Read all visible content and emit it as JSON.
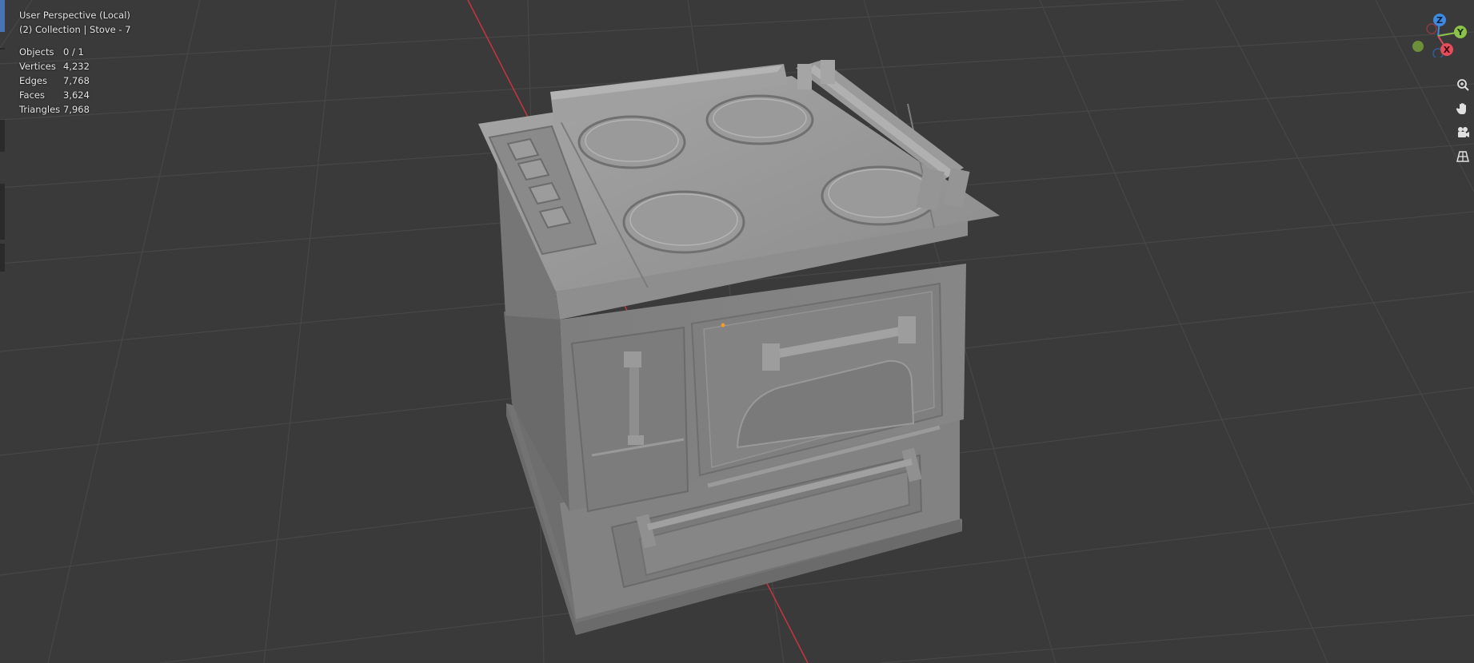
{
  "viewport": {
    "view_label": "User Perspective (Local)",
    "collection_label": "(2) Collection | Stove - 7"
  },
  "stats": [
    {
      "key": "Objects",
      "value": "0 / 1"
    },
    {
      "key": "Vertices",
      "value": "4,232"
    },
    {
      "key": "Edges",
      "value": "7,768"
    },
    {
      "key": "Faces",
      "value": "3,624"
    },
    {
      "key": "Triangles",
      "value": "7,968"
    }
  ],
  "gizmo": {
    "z_label": "Z",
    "y_label": "Y",
    "x_label": "X",
    "colors": {
      "x": "#e44d5b",
      "y": "#8bc34a",
      "z": "#3d8ae0"
    }
  },
  "nav_icons": [
    "zoom-icon",
    "pan-hand-icon",
    "camera-icon",
    "ortho-grid-icon"
  ],
  "colors": {
    "background": "#3a3a3a",
    "grid": "#474747",
    "x_axis": "#c8343f",
    "active_tool": "#4772b3"
  }
}
